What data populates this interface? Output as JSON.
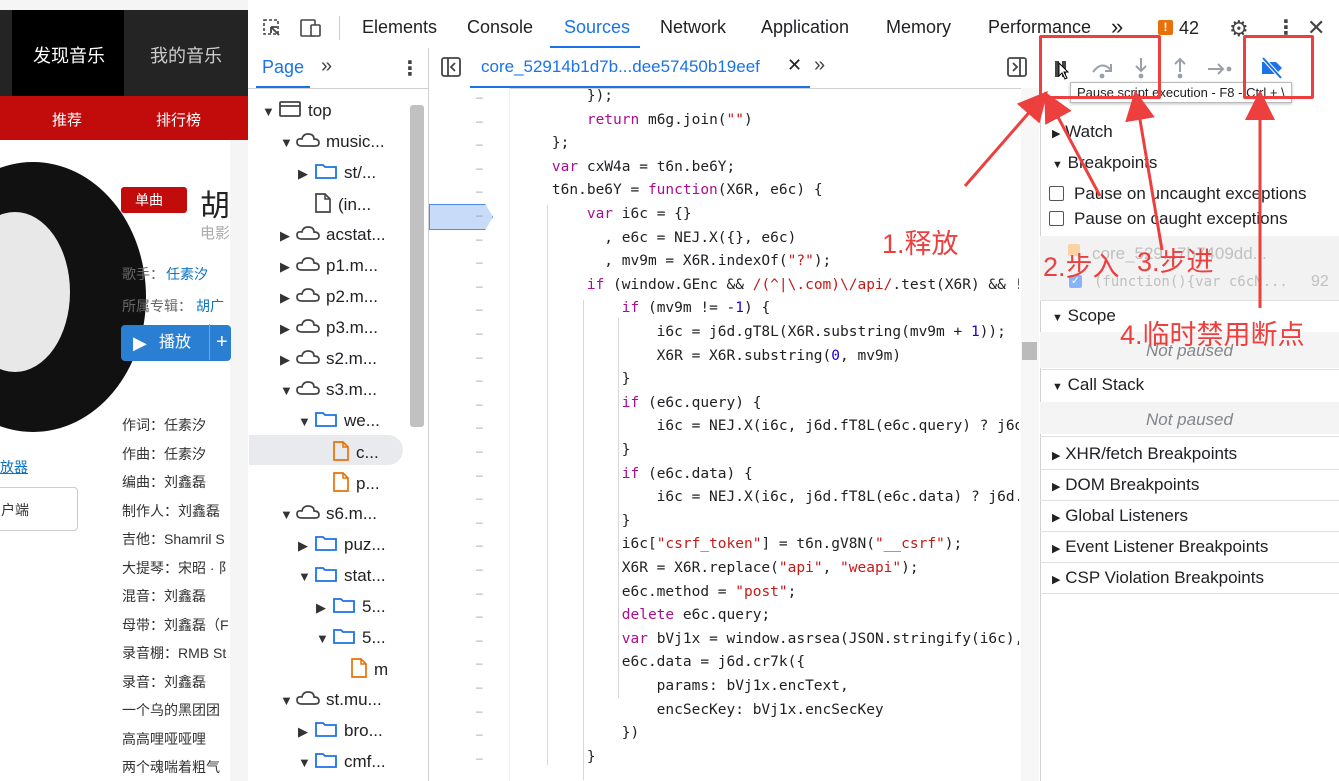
{
  "site": {
    "nav": [
      "发现音乐",
      "我的音乐"
    ],
    "subnav": [
      "推荐",
      "排行榜"
    ],
    "badge": "单曲",
    "song_title": "胡",
    "song_sub": "电影",
    "singer_label": "歌手：",
    "singer": "任素汐",
    "album_label": "所属专辑：",
    "album": "胡广",
    "play_label": "播放",
    "plus_label": "+",
    "left_link": "放器",
    "left_btn": "户端",
    "credits": [
      "作词：任素汐",
      "作曲：任素汐",
      "编曲：刘鑫磊",
      "制作人：刘鑫磊",
      "吉他：Shamril S",
      "大提琴：宋昭 · 阝",
      "混音：刘鑫磊",
      "母带：刘鑫磊（F",
      "录音棚：RMB St",
      "录音：刘鑫磊",
      "一个乌的黑团团",
      "高高哩哑哑哩",
      "两个魂喘着粗气"
    ]
  },
  "devtools": {
    "tabs": [
      "Elements",
      "Console",
      "Sources",
      "Network",
      "Application",
      "Memory",
      "Performance"
    ],
    "more": "»",
    "issues_count": "42",
    "nav_tab": "Page",
    "file_tab": "core_52914b1d7b...dee57450b19eef",
    "tree": [
      {
        "label": "top"
      },
      {
        "label": "music..."
      },
      {
        "label": "st/..."
      },
      {
        "label": "(in..."
      },
      {
        "label": "acstat..."
      },
      {
        "label": "p1.m..."
      },
      {
        "label": "p2.m..."
      },
      {
        "label": "p3.m..."
      },
      {
        "label": "s2.m..."
      },
      {
        "label": "s3.m..."
      },
      {
        "label": "we..."
      },
      {
        "label": "c..."
      },
      {
        "label": "p..."
      },
      {
        "label": "s6.m..."
      },
      {
        "label": "puz..."
      },
      {
        "label": "stat..."
      },
      {
        "label": "5..."
      },
      {
        "label": "5..."
      },
      {
        "label": "m"
      },
      {
        "label": "st.mu..."
      },
      {
        "label": "bro..."
      },
      {
        "label": "cmf..."
      }
    ],
    "code": [
      "        });",
      "        return m6g.join(\"\")",
      "    };",
      "    var cxW4a = t6n.be6Y;",
      "    t6n.be6Y = function(X6R, e6c) {",
      "        var i6c = {}",
      "          , e6c = NEJ.X({}, e6c)",
      "          , mv9m = X6R.indexOf(\"?\");",
      "        if (window.GEnc && /(^|\\.com)\\/api/.test(X6R) && !(e",
      "            if (mv9m != -1) {",
      "                i6c = j6d.gT8L(X6R.substring(mv9m + 1));",
      "                X6R = X6R.substring(0, mv9m)",
      "            }",
      "            if (e6c.query) {",
      "                i6c = NEJ.X(i6c, j6d.fT8L(e6c.query) ? j6d.g",
      "            }",
      "            if (e6c.data) {",
      "                i6c = NEJ.X(i6c, j6d.fT8L(e6c.data) ? j6d.gT",
      "            }",
      "            i6c[\"csrf_token\"] = t6n.gV8N(\"__csrf\");",
      "            X6R = X6R.replace(\"api\", \"weapi\");",
      "            e6c.method = \"post\";",
      "            delete e6c.query;",
      "            var bVj1x = window.asrsea(JSON.stringify(i6c), b",
      "            e6c.data = j6d.cr7k({",
      "                params: bVj1x.encText,",
      "                encSecKey: bVj1x.encSecKey",
      "            })",
      "        }"
    ],
    "tooltip": "Pause script execution - F8 - Ctrl + \\",
    "debugger": {
      "scope_sec": "Scope",
      "watch": "Watch",
      "breakpoints": "Breakpoints",
      "pause_uncaught": "Pause on uncaught exceptions",
      "pause_caught": "Pause on caught exceptions",
      "bp_file": "core_529...7b7409dd...",
      "bp_code": "(function(){var c6cN...",
      "bp_line": "92",
      "not_paused_1": "Not paused",
      "call_stack": "Call Stack",
      "not_paused_2": "Not paused",
      "xhr": "XHR/fetch Breakpoints",
      "dom": "DOM Breakpoints",
      "global": "Global Listeners",
      "event": "Event Listener Breakpoints",
      "csp": "CSP Violation Breakpoints"
    }
  },
  "annotations": {
    "a1": "1.释放",
    "a2": "2.步入",
    "a3": "3.步进",
    "a4": "4.临时禁用断点"
  },
  "colors": {
    "accent": "#1a73e8",
    "annotation": "#ee3f3f",
    "site_red": "#c20c0c"
  }
}
